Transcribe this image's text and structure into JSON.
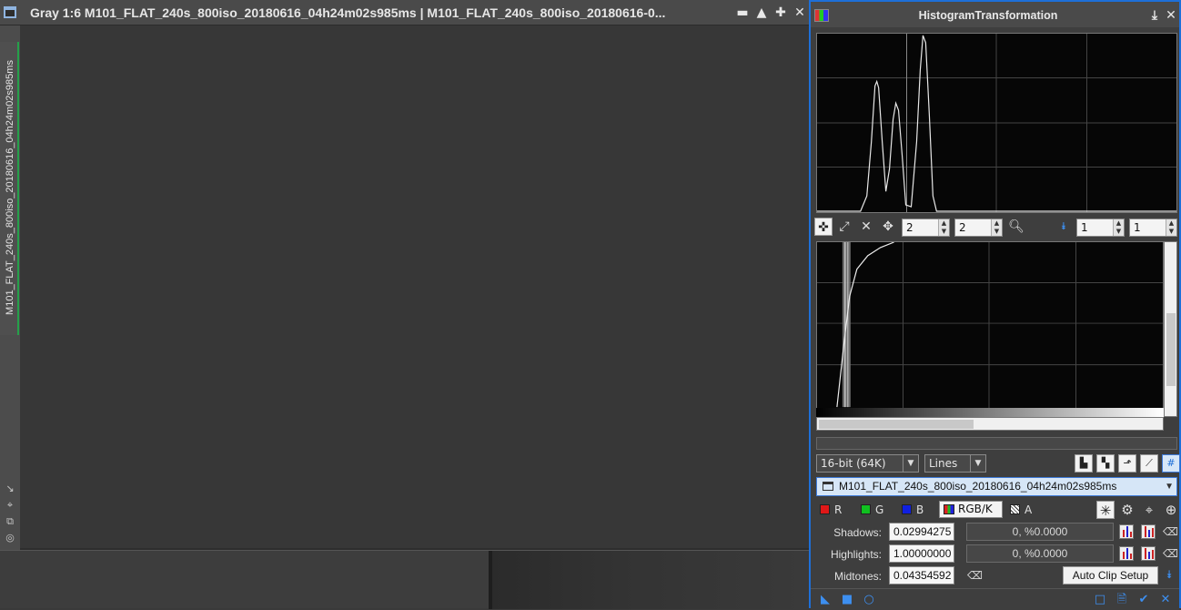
{
  "image_window": {
    "title": "Gray 1:6 M101_FLAT_240s_800iso_20180616_04h24m02s985ms | M101_FLAT_240s_800iso_20180616-0...",
    "tab_label": "M101_FLAT_240s_800iso_20180616_04h24m02s985ms",
    "buttons": {
      "shade": "▬",
      "collapse": "▲",
      "maximize": "✚",
      "close": "✕"
    },
    "side_tools": [
      "↘",
      "⌖",
      "⧉",
      "◎"
    ]
  },
  "histogram": {
    "title": "HistogramTransformation",
    "title_buttons": {
      "pin": "⤓",
      "close": "✕"
    },
    "zoom_h": "2",
    "zoom_v": "2",
    "graph_h": "1",
    "graph_v": "1",
    "resolution": "16-bit (64K)",
    "plot_mode": "Lines",
    "view": "M101_FLAT_240s_800iso_20180616_04h24m02s985ms",
    "channels": {
      "r": "R",
      "g": "G",
      "b": "B",
      "rgbk": "RGB/K",
      "a": "A"
    },
    "params": {
      "shadows_label": "Shadows:",
      "shadows_value": "0.02994275",
      "shadows_info": "0, %0.0000",
      "highlights_label": "Highlights:",
      "highlights_value": "1.00000000",
      "highlights_info": "0, %0.0000",
      "midtones_label": "Midtones:",
      "midtones_value": "0.04354592"
    },
    "auto_clip_label": "Auto Clip Setup",
    "colors": {
      "accent": "#1e6fd8",
      "red": "#e01818",
      "green": "#10c020",
      "blue": "#1020e0"
    }
  }
}
